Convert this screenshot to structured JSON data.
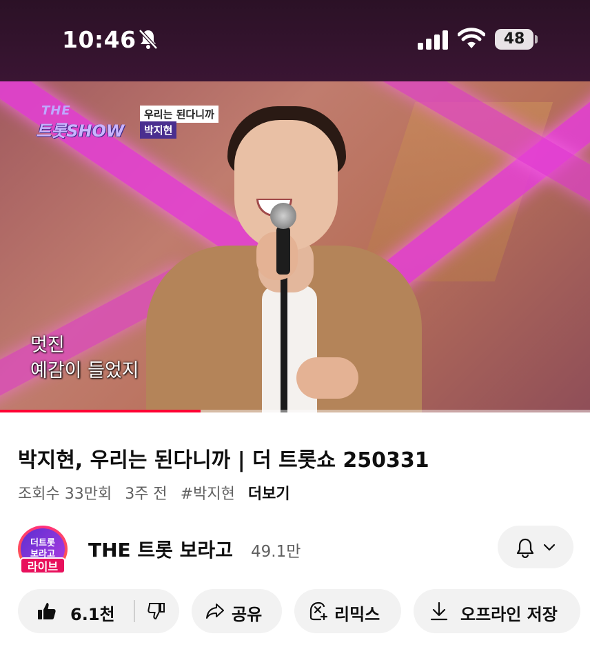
{
  "status_bar": {
    "time": "10:46",
    "battery": "48"
  },
  "video": {
    "overlay": {
      "logo_the": "THE",
      "logo_main": "트롯SHOW",
      "song": "우리는 된다니까",
      "singer": "박지현"
    },
    "subtitle_line1": "멋진",
    "subtitle_line2": "예감이 들었지",
    "progress": 0.34,
    "progress_color": "#ff0033"
  },
  "info": {
    "title": "박지현, 우리는 된다니까 | 더 트롯쇼 250331",
    "views": "조회수 33만회",
    "age": "3주 전",
    "hashtag": "#박지현",
    "more": "더보기"
  },
  "channel": {
    "avatar_text1": "더트롯",
    "avatar_text2": "보라고",
    "live_badge": "라이브",
    "name": "THE 트롯 보라고",
    "subscribers": "49.1만"
  },
  "actions": {
    "like_count": "6.1천",
    "share": "공유",
    "remix": "리믹스",
    "download": "오프라인 저장"
  },
  "icons": [
    "bell-off-icon",
    "signal-icon",
    "wifi-icon",
    "battery-icon",
    "bell-icon",
    "chevron-down-icon",
    "thumbs-up-icon",
    "thumbs-down-icon",
    "share-icon",
    "remix-icon",
    "download-icon"
  ]
}
